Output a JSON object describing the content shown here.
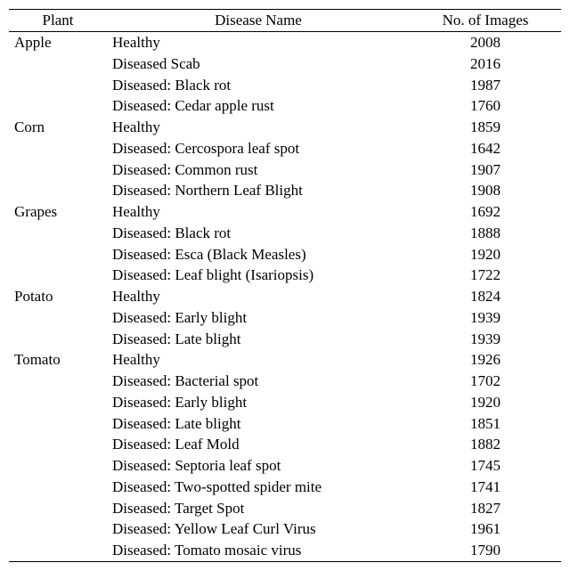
{
  "chart_data": {
    "type": "table",
    "columns": [
      "Plant",
      "Disease Name",
      "No. of Images"
    ],
    "rows": [
      {
        "plant": "Apple",
        "disease": "Healthy",
        "count": 2008
      },
      {
        "plant": "",
        "disease": "Diseased Scab",
        "count": 2016
      },
      {
        "plant": "",
        "disease": "Diseased: Black rot",
        "count": 1987
      },
      {
        "plant": "",
        "disease": "Diseased: Cedar apple rust",
        "count": 1760
      },
      {
        "plant": "Corn",
        "disease": "Healthy",
        "count": 1859
      },
      {
        "plant": "",
        "disease": "Diseased: Cercospora leaf spot",
        "count": 1642
      },
      {
        "plant": "",
        "disease": "Diseased: Common rust",
        "count": 1907
      },
      {
        "plant": "",
        "disease": "Diseased: Northern Leaf Blight",
        "count": 1908
      },
      {
        "plant": "Grapes",
        "disease": "Healthy",
        "count": 1692
      },
      {
        "plant": "",
        "disease": "Diseased: Black rot",
        "count": 1888
      },
      {
        "plant": "",
        "disease": "Diseased: Esca (Black Measles)",
        "count": 1920
      },
      {
        "plant": "",
        "disease": "Diseased: Leaf blight (Isariopsis)",
        "count": 1722
      },
      {
        "plant": "Potato",
        "disease": "Healthy",
        "count": 1824
      },
      {
        "plant": "",
        "disease": "Diseased: Early blight",
        "count": 1939
      },
      {
        "plant": "",
        "disease": "Diseased: Late blight",
        "count": 1939
      },
      {
        "plant": " Tomato",
        "disease": "Healthy",
        "count": 1926
      },
      {
        "plant": "",
        "disease": "Diseased: Bacterial spot",
        "count": 1702
      },
      {
        "plant": "",
        "disease": "Diseased: Early blight",
        "count": 1920
      },
      {
        "plant": "",
        "disease": "Diseased: Late blight",
        "count": 1851
      },
      {
        "plant": "",
        "disease": "Diseased: Leaf Mold",
        "count": 1882
      },
      {
        "plant": "",
        "disease": "Diseased: Septoria leaf spot",
        "count": 1745
      },
      {
        "plant": "",
        "disease": "Diseased: Two-spotted spider mite",
        "count": 1741
      },
      {
        "plant": "",
        "disease": "Diseased: Target Spot",
        "count": 1827
      },
      {
        "plant": "",
        "disease": "Diseased: Yellow Leaf Curl Virus",
        "count": 1961
      },
      {
        "plant": "",
        "disease": "Diseased: Tomato mosaic virus",
        "count": 1790
      }
    ]
  }
}
